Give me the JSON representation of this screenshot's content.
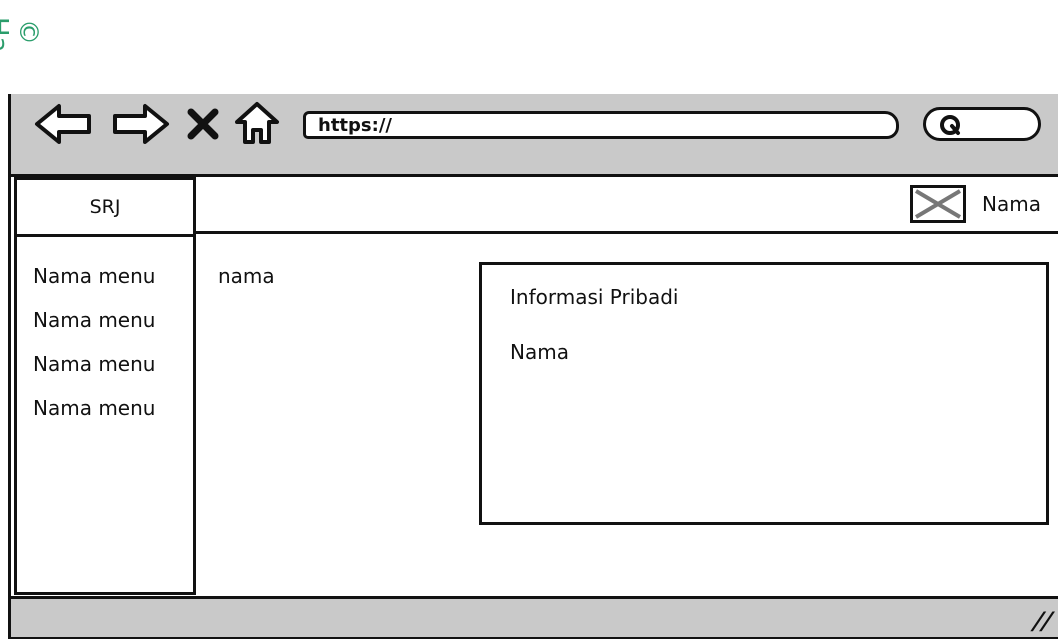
{
  "watermark": {
    "text": "© Ha"
  },
  "browser": {
    "url": "https://",
    "icons": [
      "back-arrow-icon",
      "forward-arrow-icon",
      "close-icon",
      "home-icon",
      "search-icon"
    ]
  },
  "app": {
    "brand": "SRJ",
    "menu": [
      "Nama menu",
      "Nama menu",
      "Nama menu",
      "Nama menu"
    ],
    "header": {
      "user_name": "Nama"
    },
    "breadcrumb": "nama",
    "panel": {
      "title": "Informasi Pribadi",
      "name_label": "Nama"
    }
  },
  "colors": {
    "toolbar": "#c9c9c9",
    "watermark": "#2a9d6b",
    "ink": "#111111"
  }
}
